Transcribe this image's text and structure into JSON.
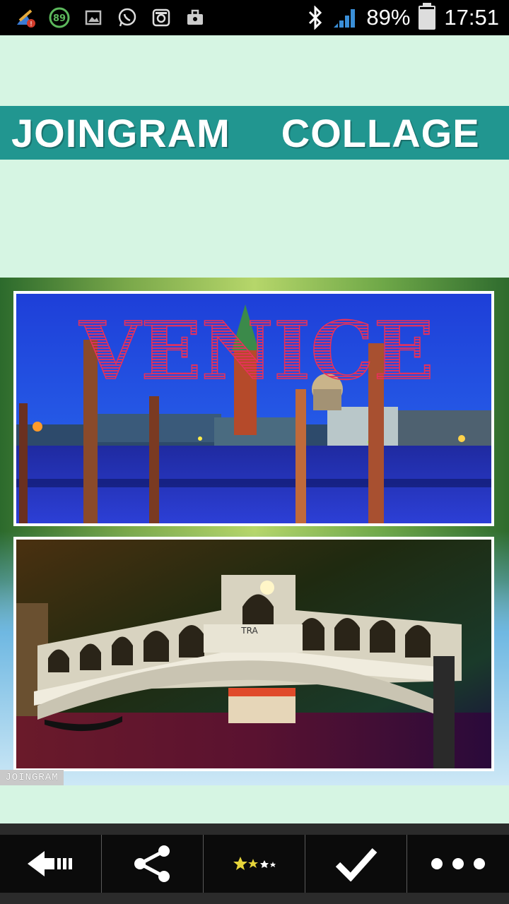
{
  "status_bar": {
    "battery_percent": "89%",
    "battery_level": 0.89,
    "time": "17:51",
    "notification_badge": "89",
    "icons": [
      "app-update-icon",
      "badge-89-icon",
      "gallery-icon",
      "whatsapp-icon",
      "instagram-icon",
      "briefcase-icon",
      "bluetooth-icon",
      "signal-icon",
      "battery-icon"
    ]
  },
  "banner": {
    "word1": "JOINGRAM",
    "word2": "COLLAGE",
    "color": "#219690"
  },
  "collage": {
    "top_photo_text": "VENICE",
    "bottom_photo_sign": "TRA",
    "watermark": "JOINGRAM"
  },
  "toolbar": {
    "icons": [
      "back-arrow-icon",
      "share-icon",
      "rate-stars-icon",
      "checkmark-icon",
      "more-dots-icon"
    ]
  }
}
